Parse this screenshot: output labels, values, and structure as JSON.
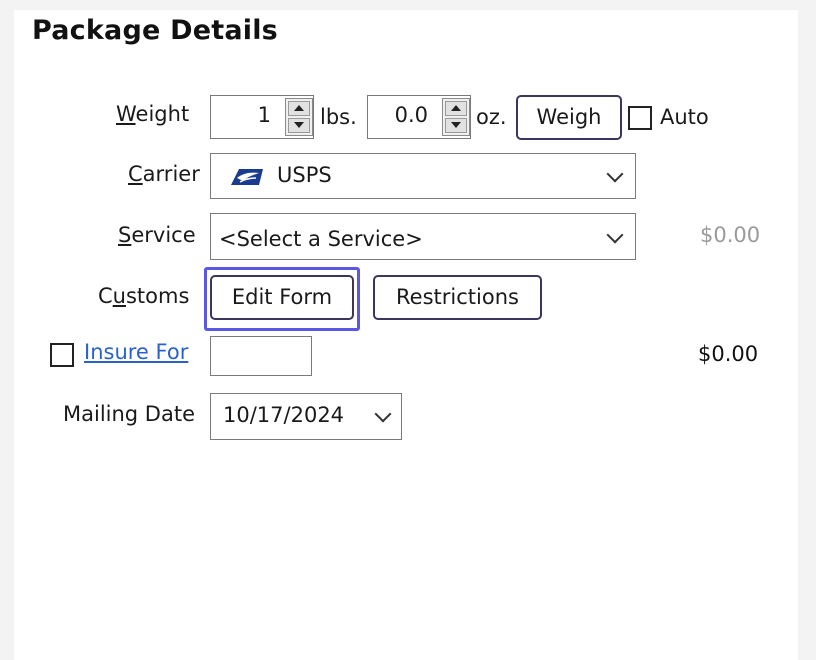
{
  "title": "Package Details",
  "weight": {
    "label_ul": "W",
    "label_rest": "eight",
    "lbs_value": "1",
    "lbs_unit": "lbs.",
    "oz_value": "0.0",
    "oz_unit": "oz.",
    "weigh_button": "Weigh",
    "auto_label": "Auto"
  },
  "carrier": {
    "label_ul": "C",
    "label_rest": "arrier",
    "value": "USPS",
    "icon": "usps-eagle-icon"
  },
  "service": {
    "label_ul": "S",
    "label_rest": "ervice",
    "value": "<Select a Service>",
    "price": "$0.00"
  },
  "customs": {
    "label_pre": "C",
    "label_ul": "u",
    "label_post": "stoms",
    "edit_button": "Edit Form",
    "restrictions_button": "Restrictions"
  },
  "insure": {
    "label": "Insure For",
    "value": "",
    "price": "$0.00"
  },
  "mailing": {
    "label": "Mailing Date",
    "value": "10/17/2024"
  },
  "colors": {
    "accent_focus": "#5b57e6",
    "button_border": "#3b3560",
    "link": "#2a62c9",
    "usps_blue": "#1b3b8f"
  }
}
